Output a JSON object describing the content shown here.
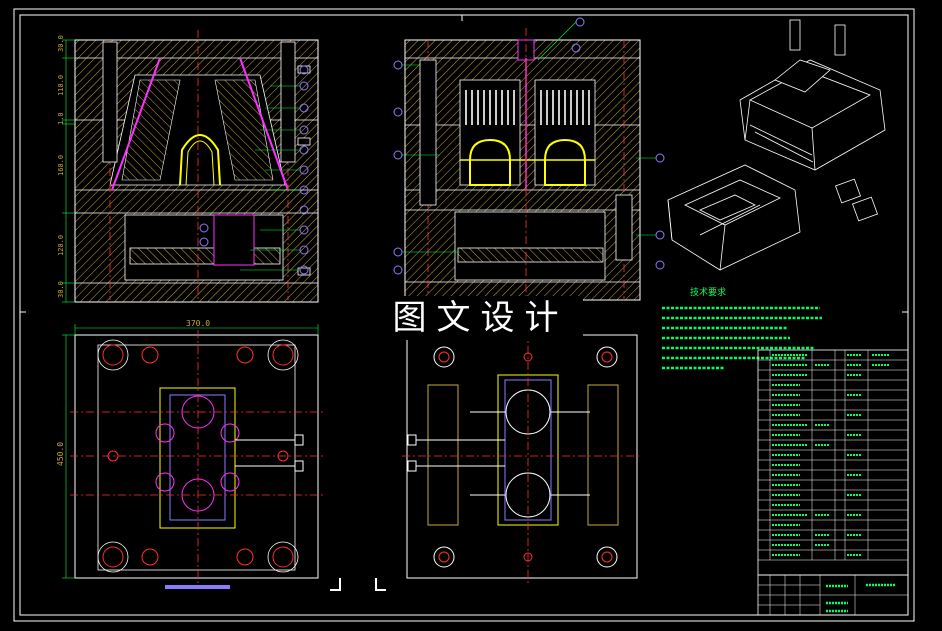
{
  "watermark": "图文设计",
  "dims": {
    "front_width": "370.0",
    "front_height": "450.0",
    "side_stack": [
      "30.0",
      "110.0",
      "1.0",
      "160.0",
      "120.0",
      "30.0"
    ]
  },
  "tech_requirements": {
    "title": "技术要求"
  },
  "colors": {
    "background": "#000000",
    "frame": "#ffffff",
    "hatch": "#c8a83c",
    "part_yellow": "#ffff00",
    "balloon": "#8a7cff",
    "leader": "#00ff3c",
    "centerline": "#ff3030",
    "text_green": "#00ff60",
    "magenta": "#ff30ff",
    "cyan": "#00e0ff"
  }
}
